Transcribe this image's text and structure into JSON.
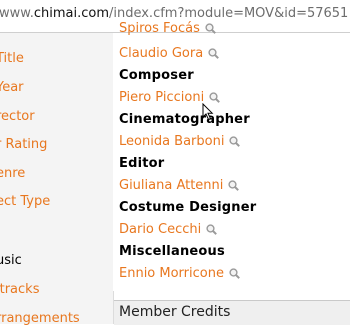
{
  "address_bar": {
    "prefix": "www.",
    "host": "chimai.com",
    "path": "/index.cfm?module=MOV&id=57651"
  },
  "sidebar": {
    "items": [
      {
        "label": "Title",
        "color": "#e8771f"
      },
      {
        "label": "Year",
        "color": "#e8771f"
      },
      {
        "label": "rector",
        "color": "#e8771f"
      },
      {
        "label": "r Rating",
        "color": "#e8771f"
      },
      {
        "label": "enre",
        "color": "#e8771f"
      },
      {
        "label": "ect Type",
        "color": "#e8771f"
      },
      {
        "label": "usic",
        "color": "#000000"
      },
      {
        "label": "ltracks",
        "color": "#e8771f"
      },
      {
        "label": "rrangements",
        "color": "#e8771f"
      }
    ]
  },
  "credits": {
    "top_partial": "Spiros Focás",
    "rows": [
      {
        "type": "person",
        "text": "Claudio Gora",
        "icon": "magnifier-icon"
      },
      {
        "type": "heading",
        "text": "Composer"
      },
      {
        "type": "person",
        "text": "Piero Piccioni",
        "icon": "magnifier-icon"
      },
      {
        "type": "heading",
        "text": "Cinematographer"
      },
      {
        "type": "person",
        "text": "Leonida Barboni",
        "icon": "magnifier-icon"
      },
      {
        "type": "heading",
        "text": "Editor"
      },
      {
        "type": "person",
        "text": "Giuliana Attenni",
        "icon": "magnifier-icon"
      },
      {
        "type": "heading",
        "text": "Costume Designer"
      },
      {
        "type": "person",
        "text": "Dario Cecchi",
        "icon": "magnifier-icon"
      },
      {
        "type": "heading",
        "text": "Miscellaneous"
      },
      {
        "type": "person",
        "text": "Ennio Morricone",
        "icon": "magnifier-icon"
      }
    ]
  },
  "member_credits": {
    "label": "Member Credits"
  },
  "colors": {
    "link_orange": "#e8771f",
    "sidebar_bg": "#f4f4f4"
  }
}
